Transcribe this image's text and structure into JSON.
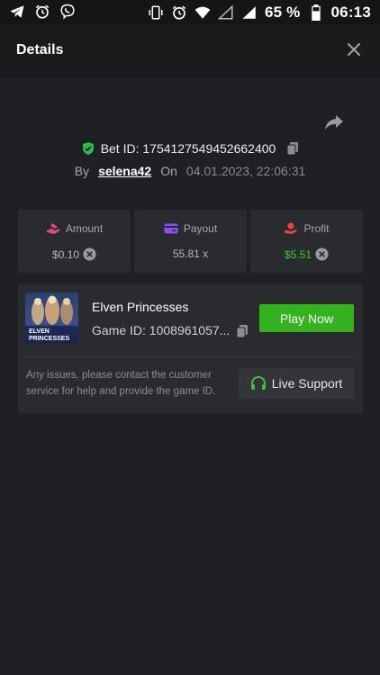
{
  "status_bar": {
    "battery_percent": "65 %",
    "time": "06:13",
    "left_icons": [
      "telegram-icon",
      "alarm-icon",
      "viber-icon"
    ],
    "right_icons": [
      "vibrate-icon",
      "alarm-icon",
      "wifi-icon",
      "signal-empty-icon",
      "signal-icon",
      "battery-icon"
    ]
  },
  "header": {
    "title": "Details"
  },
  "bet": {
    "id_label": "Bet ID: 1754127549452662400",
    "by_label": "By",
    "user": "selena42",
    "on_label": "On",
    "date": "04.01.2023, 22:06:31"
  },
  "stats": {
    "amount": {
      "label": "Amount",
      "value": "$0.10"
    },
    "payout": {
      "label": "Payout",
      "value": "55.81 x"
    },
    "profit": {
      "label": "Profit",
      "value": "$5.51"
    }
  },
  "game": {
    "name": "Elven Princesses",
    "game_id": "Game ID: 1008961057...",
    "thumb_text_top": "ELVEN",
    "thumb_text_mid": "PRINCESSES",
    "play_label": "Play Now"
  },
  "support": {
    "text": "Any issues, please contact the customer service for help and provide the game ID.",
    "button_label": "Live Support"
  },
  "colors": {
    "background": "#1f2023",
    "card": "#2a2b2f",
    "accent_green": "#35b21f",
    "profit_green": "#43c43a",
    "shield_green": "#2fb84e",
    "amount_pink": "#e8457a",
    "payout_purple": "#8a4df0",
    "profit_red": "#e2453c"
  }
}
